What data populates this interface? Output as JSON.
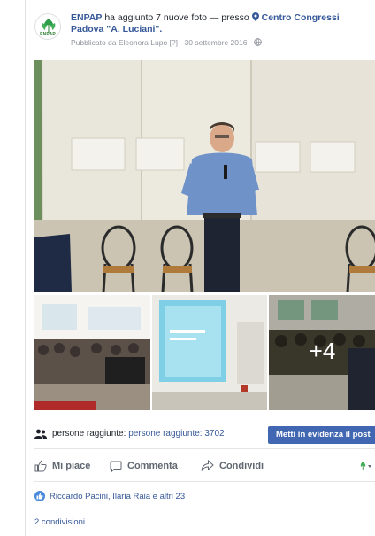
{
  "post": {
    "page_name": "ENPAP",
    "action_text": "ha aggiunto 7 nuove foto — presso",
    "location": "Centro Congressi Padova \"A. Luciani\".",
    "published_by": "Pubblicato da Eleonora Lupo",
    "published_help": "[?]",
    "date": "· 30 settembre 2016 ·",
    "avatar_logo_text": "ENPAP",
    "icons": {
      "privacy": "globe-icon",
      "location": "map-pin-icon"
    }
  },
  "photos": {
    "more_count": "+4"
  },
  "reach": {
    "label": "persone raggiunte:",
    "count_label": "persone raggiunte: 3702",
    "boost_label": "Metti in evidenza il post"
  },
  "actions": {
    "like": "Mi piace",
    "comment": "Commenta",
    "share": "Condividi"
  },
  "likes_summary": "Riccardo Pacini, Ilaria Raia e altri 23",
  "shares_summary": "2 condivisioni",
  "colors": {
    "link": "#365899",
    "boost_button": "#4267b2",
    "muted": "#90949c",
    "action_gray": "#606770"
  }
}
